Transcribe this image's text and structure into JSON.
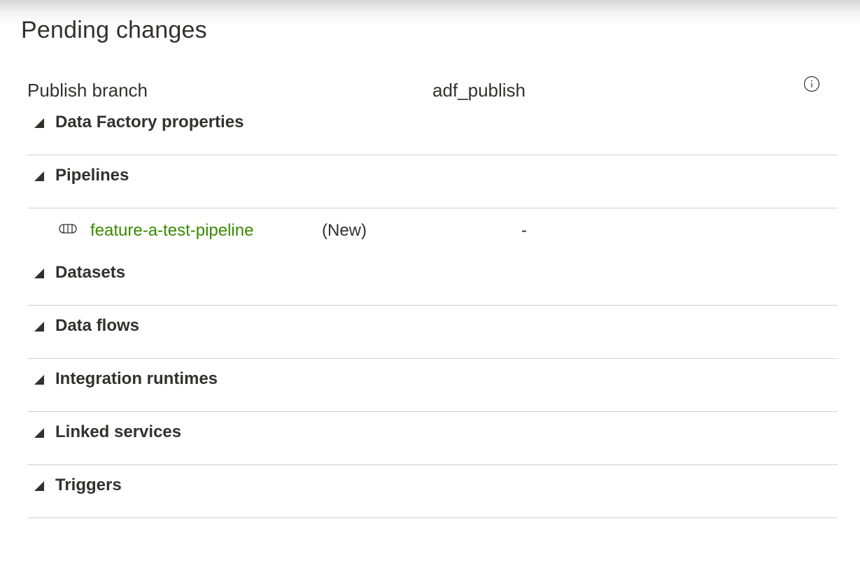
{
  "page": {
    "title": "Pending changes"
  },
  "publish_branch": {
    "label": "Publish branch",
    "value": "adf_publish",
    "info_icon": "info-icon"
  },
  "sections": [
    {
      "label": "Data Factory properties",
      "icon": "caret-expanded-icon"
    },
    {
      "label": "Pipelines",
      "icon": "caret-expanded-icon"
    },
    {
      "label": "Datasets",
      "icon": "caret-expanded-icon"
    },
    {
      "label": "Data flows",
      "icon": "caret-expanded-icon"
    },
    {
      "label": "Integration runtimes",
      "icon": "caret-expanded-icon"
    },
    {
      "label": "Linked services",
      "icon": "caret-expanded-icon"
    },
    {
      "label": "Triggers",
      "icon": "caret-expanded-icon"
    }
  ],
  "pipelines": {
    "items": [
      {
        "name": "feature-a-test-pipeline",
        "status": "(New)",
        "detail": "-",
        "icon": "pipeline-icon"
      }
    ]
  },
  "colors": {
    "link": "#3a8a00",
    "text": "#323130",
    "divider": "#d2d0ce"
  }
}
